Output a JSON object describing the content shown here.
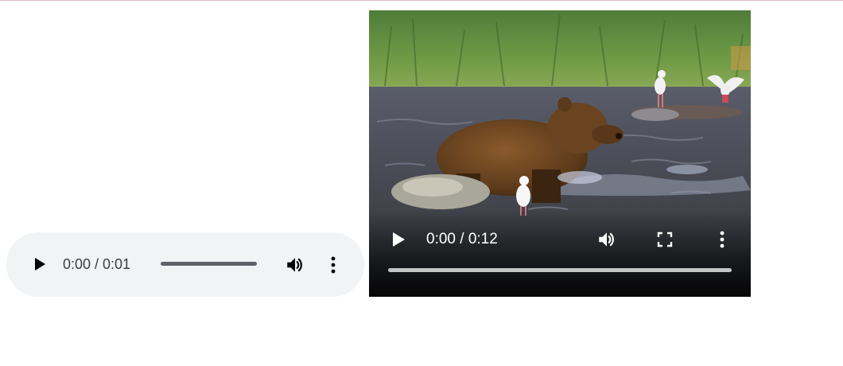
{
  "audio_player": {
    "time_display": "0:00 / 0:01",
    "progress": 0,
    "icons": {
      "play": "play-icon",
      "volume": "volume-icon",
      "menu": "more-vert-icon"
    },
    "colors": {
      "background": "#f1f3f4",
      "icon": "#000000",
      "track": "#5f6368"
    }
  },
  "video_player": {
    "time_display": "0:00 / 0:12",
    "progress": 0,
    "icons": {
      "play": "play-icon",
      "volume": "volume-icon",
      "fullscreen": "fullscreen-icon",
      "menu": "more-vert-icon"
    },
    "frame_content": "bear-in-river-with-seagulls",
    "colors": {
      "icon": "#ffffff",
      "track": "#cccccc"
    }
  }
}
